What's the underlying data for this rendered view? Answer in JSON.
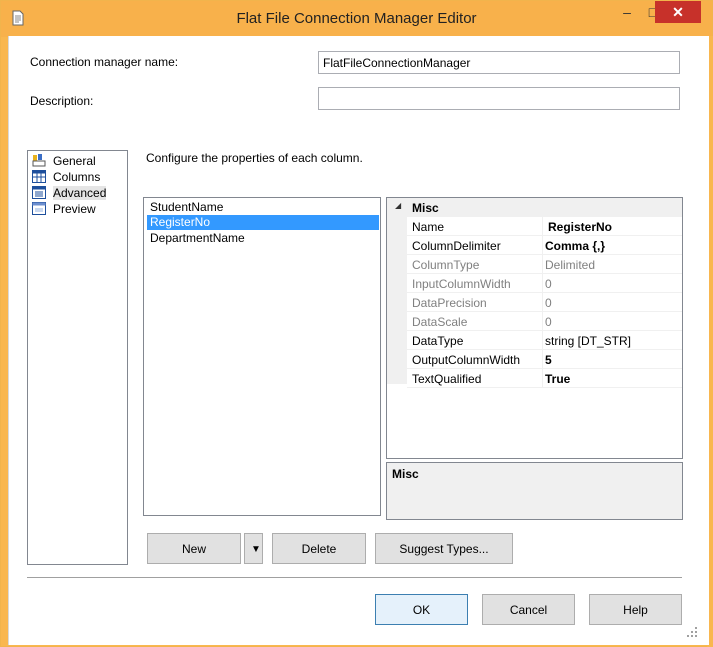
{
  "window": {
    "title": "Flat File Connection Manager Editor",
    "minimize_glyph": "–",
    "maximize_glyph": "□",
    "close_glyph": "✕"
  },
  "form": {
    "connection_label": "Connection manager name:",
    "connection_value": "FlatFileConnectionManager",
    "description_label": "Description:",
    "description_value": ""
  },
  "nav": {
    "items": [
      {
        "label": "General",
        "icon": "general-icon"
      },
      {
        "label": "Columns",
        "icon": "columns-icon"
      },
      {
        "label": "Advanced",
        "icon": "advanced-icon",
        "selected": true
      },
      {
        "label": "Preview",
        "icon": "preview-icon"
      }
    ]
  },
  "main": {
    "instruction": "Configure the properties of each column."
  },
  "columns": {
    "items": [
      {
        "label": "StudentName"
      },
      {
        "label": "RegisterNo",
        "selected": true
      },
      {
        "label": "DepartmentName"
      }
    ]
  },
  "propgrid": {
    "category": "Misc",
    "expander_glyph": "◢",
    "rows": [
      {
        "name": "Name",
        "value": "RegisterNo",
        "readonly": false,
        "bold": true
      },
      {
        "name": "ColumnDelimiter",
        "value": "Comma {,}",
        "readonly": false,
        "bold": true
      },
      {
        "name": "ColumnType",
        "value": "Delimited",
        "readonly": true,
        "bold": false
      },
      {
        "name": "InputColumnWidth",
        "value": "0",
        "readonly": true,
        "bold": false
      },
      {
        "name": "DataPrecision",
        "value": "0",
        "readonly": true,
        "bold": false
      },
      {
        "name": "DataScale",
        "value": "0",
        "readonly": true,
        "bold": false
      },
      {
        "name": "DataType",
        "value": "string [DT_STR]",
        "readonly": false,
        "bold": false
      },
      {
        "name": "OutputColumnWidth",
        "value": "5",
        "readonly": false,
        "bold": true
      },
      {
        "name": "TextQualified",
        "value": "True",
        "readonly": false,
        "bold": true
      }
    ],
    "description_title": "Misc"
  },
  "buttons": {
    "new": "New",
    "dropdown_glyph": "▼",
    "delete": "Delete",
    "suggest": "Suggest Types...",
    "ok": "OK",
    "cancel": "Cancel",
    "help": "Help"
  },
  "colors": {
    "titlebar": "#f8b14b",
    "close": "#c7312a",
    "selection": "#3399ff"
  }
}
